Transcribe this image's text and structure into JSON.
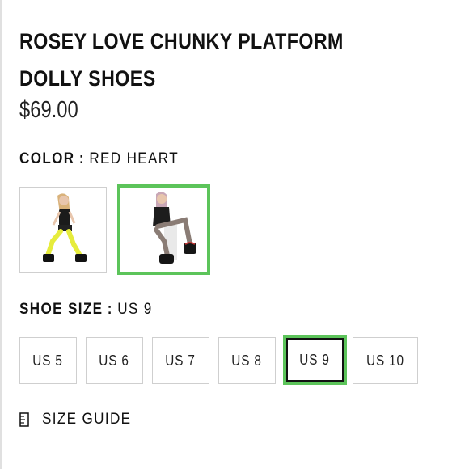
{
  "product": {
    "title": "ROSEY LOVE CHUNKY PLATFORM DOLLY SHOES",
    "price": "$69.00"
  },
  "color_option": {
    "label": "COLOR",
    "separator": ":",
    "selected_value": "RED HEART",
    "swatches": [
      {
        "icon": "model-yellow-tights-thumbnail",
        "selected": false
      },
      {
        "icon": "model-fishnet-tights-thumbnail",
        "selected": true
      }
    ],
    "selected_border_color": "#5cc45a"
  },
  "size_option": {
    "label": "SHOE SIZE",
    "separator": ":",
    "selected_value": "US 9",
    "sizes": [
      "US 5",
      "US 6",
      "US 7",
      "US 8",
      "US 9",
      "US 10"
    ],
    "selected_index": 4
  },
  "size_guide": {
    "icon": "ruler-icon",
    "label": "SIZE GUIDE"
  }
}
